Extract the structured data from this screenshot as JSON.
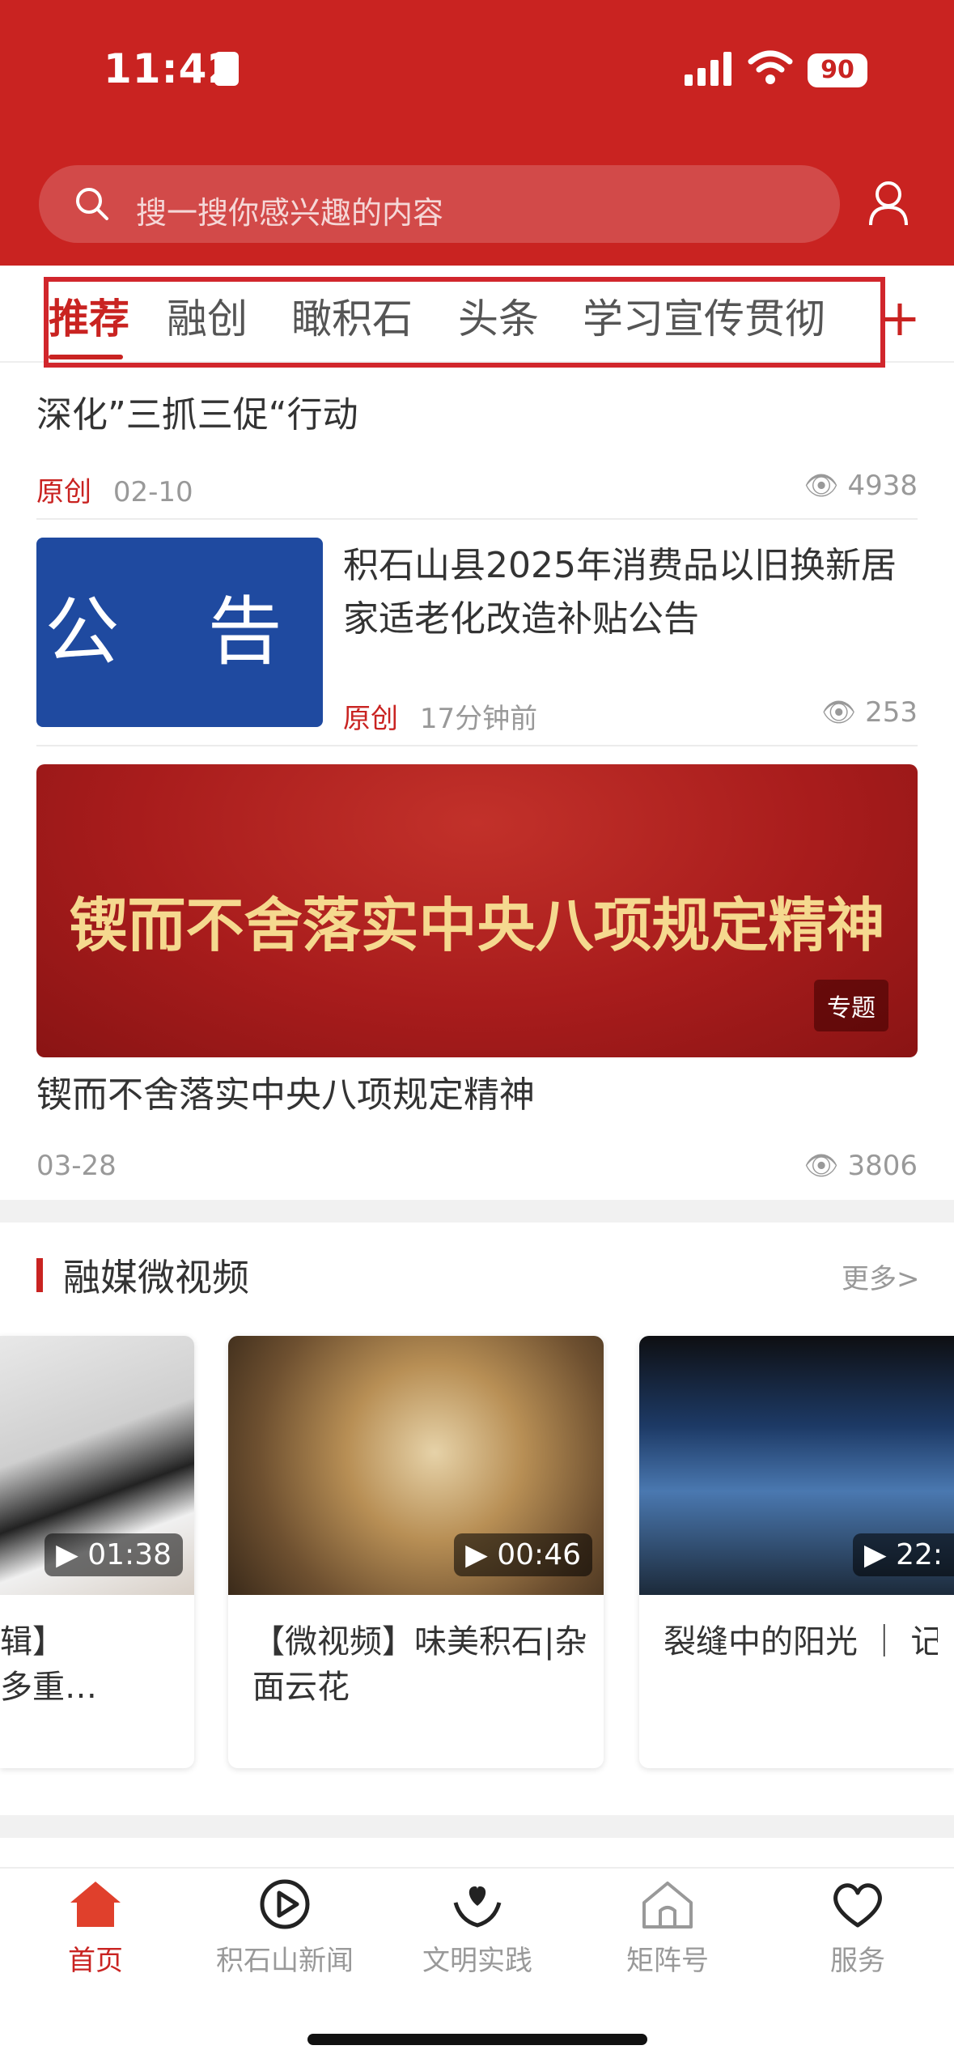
{
  "status_bar": {
    "time": "11:42",
    "battery": "90"
  },
  "search": {
    "placeholder": "搜一搜你感兴趣的内容"
  },
  "tabs": [
    "推荐",
    "融创",
    "瞰积石",
    "头条",
    "学习宣传贯彻"
  ],
  "tabs_add": "+",
  "articles": [
    {
      "title": "深化”三抓三促“行动",
      "source": "原创",
      "date": "02-10",
      "views": "4938"
    },
    {
      "title": "积石山县2025年消费品以旧换新居家适老化改造补贴公告",
      "image_text": "公 告",
      "source": "原创",
      "date": "17分钟前",
      "views": "253"
    },
    {
      "title": "锲而不舍落实中央八项规定精神",
      "banner_text": "锲而不舍落实中央八项规定精神",
      "tag": "专题",
      "date": "03-28",
      "views": "3806"
    }
  ],
  "video_section": {
    "title": "融媒微视频",
    "more": "更多>",
    "videos": [
      {
        "duration": "01:38",
        "title": "辑】\n多重…"
      },
      {
        "duration": "00:46",
        "title": "【微视频】味美积石|杂面云花"
      },
      {
        "duration": "22:",
        "title": "裂缝中的阳光 ｜ 记战在积石山地震灾…"
      }
    ]
  },
  "tab_bar": {
    "items": [
      {
        "label": "首页",
        "icon": "home-icon"
      },
      {
        "label": "积石山新闻",
        "icon": "play-icon"
      },
      {
        "label": "文明实践",
        "icon": "heart-hands-icon"
      },
      {
        "label": "矩阵号",
        "icon": "house-icon"
      },
      {
        "label": "服务",
        "icon": "heart-icon"
      }
    ]
  },
  "colors": {
    "brand_red": "#c92321",
    "notice_blue": "#1f4aa0"
  }
}
